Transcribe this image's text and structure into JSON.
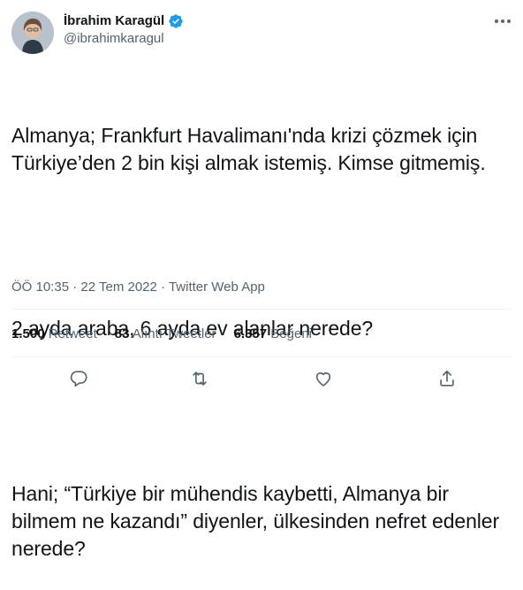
{
  "author": {
    "name": "İbrahim Karagül",
    "handle": "@ibrahimkaragul",
    "verified": true
  },
  "tweet": {
    "paragraphs": [
      "Almanya; Frankfurt Havalimanı'nda krizi çözmek için Türkiye’den 2 bin kişi almak istemiş. Kimse gitmemiş.",
      "2 ayda araba, 6 ayda ev alanlar nerede?",
      "Hani; “Türkiye bir mühendis kaybetti, Almanya bir bilmem ne kazandı” diyenler, ülkesinden nefret edenler nerede?"
    ],
    "time": "ÖÖ 10:35",
    "date": "22 Tem 2022",
    "separator": "·",
    "source": "Twitter Web App"
  },
  "stats": {
    "retweets_count": "1.500",
    "retweets_label": "Retweet",
    "quotes_count": "83",
    "quotes_label": "Alıntı Tweetler",
    "likes_count": "6.357",
    "likes_label": "Beğeni"
  },
  "colors": {
    "accent": "#1d9bf0",
    "secondary_text": "#536471",
    "divider": "#eff3f4"
  },
  "icons": [
    "verified-badge-icon",
    "more-options-icon",
    "reply-icon",
    "retweet-icon",
    "like-icon",
    "share-icon"
  ]
}
